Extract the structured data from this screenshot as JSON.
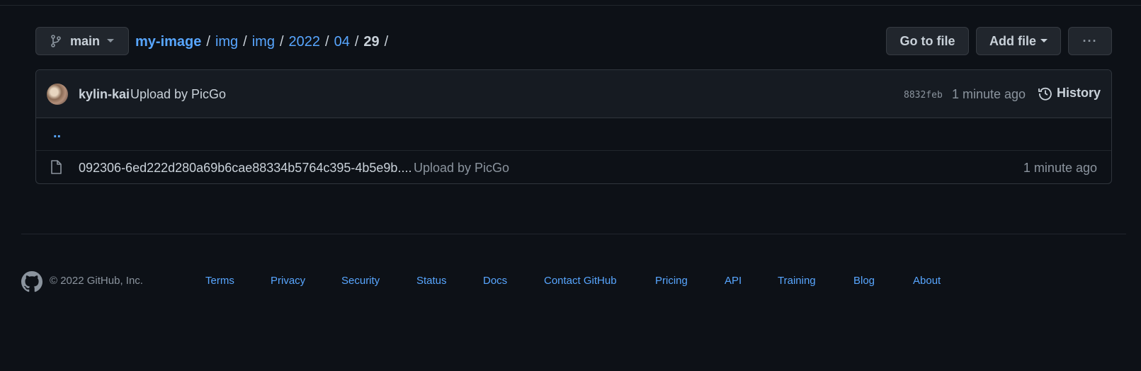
{
  "branch": {
    "label": "main"
  },
  "breadcrumb": {
    "repo": "my-image",
    "segments": [
      "img",
      "img",
      "2022",
      "04"
    ],
    "current": "29",
    "separator": "/"
  },
  "actions": {
    "goto_file": "Go to file",
    "add_file": "Add file",
    "more": "···"
  },
  "commit": {
    "author": "kylin-kai",
    "message": "Upload by PicGo",
    "sha": "8832feb",
    "time": "1 minute ago",
    "history_label": "History"
  },
  "listing": {
    "parent_dir": "..",
    "files": [
      {
        "name": "092306-6ed222d280a69b6cae88334b5764c395-4b5e9b....",
        "message": "Upload by PicGo",
        "time": "1 minute ago"
      }
    ]
  },
  "footer": {
    "copyright": "© 2022 GitHub, Inc.",
    "links": [
      "Terms",
      "Privacy",
      "Security",
      "Status",
      "Docs",
      "Contact GitHub",
      "Pricing",
      "API",
      "Training",
      "Blog",
      "About"
    ]
  },
  "colors": {
    "background": "#0d1117",
    "link": "#58a6ff",
    "text": "#c9d1d9",
    "muted": "#8b949e",
    "border": "#30363d"
  },
  "icons": {
    "branch": "git-branch-icon",
    "history": "history-clock-icon",
    "file": "file-icon",
    "footer_logo": "github-logo-icon"
  }
}
